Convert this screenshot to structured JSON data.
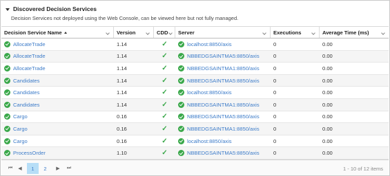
{
  "panel": {
    "title": "Discovered Decision Services",
    "subtitle": "Decision Services not deployed using the Web Console, can be viewed here but not fully managed."
  },
  "columns": {
    "name": "Decision Service Name",
    "version": "Version",
    "cdd": "CDD",
    "server": "Server",
    "executions": "Executions",
    "avg_time": "Average Time (ms)"
  },
  "rows": [
    {
      "name": "AllocateTrade",
      "version": "1.14",
      "cdd": "✓",
      "server": "localhost:8850/axis",
      "executions": "0",
      "avg": "0.00"
    },
    {
      "name": "AllocateTrade",
      "version": "1.14",
      "cdd": "✓",
      "server": "NBBEDGSAINTMA5:8850/axis",
      "executions": "0",
      "avg": "0.00"
    },
    {
      "name": "AllocateTrade",
      "version": "1.14",
      "cdd": "✓",
      "server": "NBBEDGSAINTMA1:8850/axis",
      "executions": "0",
      "avg": "0.00"
    },
    {
      "name": "Candidates",
      "version": "1.14",
      "cdd": "✓",
      "server": "NBBEDGSAINTMA5:8850/axis",
      "executions": "0",
      "avg": "0.00"
    },
    {
      "name": "Candidates",
      "version": "1.14",
      "cdd": "✓",
      "server": "localhost:8850/axis",
      "executions": "0",
      "avg": "0.00"
    },
    {
      "name": "Candidates",
      "version": "1.14",
      "cdd": "✓",
      "server": "NBBEDGSAINTMA1:8850/axis",
      "executions": "0",
      "avg": "0.00"
    },
    {
      "name": "Cargo",
      "version": "0.16",
      "cdd": "✓",
      "server": "NBBEDGSAINTMA5:8850/axis",
      "executions": "0",
      "avg": "0.00"
    },
    {
      "name": "Cargo",
      "version": "0.16",
      "cdd": "✓",
      "server": "NBBEDGSAINTMA1:8850/axis",
      "executions": "0",
      "avg": "0.00"
    },
    {
      "name": "Cargo",
      "version": "0.16",
      "cdd": "✓",
      "server": "localhost:8850/axis",
      "executions": "0",
      "avg": "0.00"
    },
    {
      "name": "ProcessOrder",
      "version": "1.10",
      "cdd": "✓",
      "server": "NBBEDGSAINTMA5:8850/axis",
      "executions": "0",
      "avg": "0.00"
    }
  ],
  "pager": {
    "first": "⏮",
    "prev": "◀",
    "next": "▶",
    "last": "⏭",
    "pages": [
      "1",
      "2"
    ],
    "current_page": "1",
    "info": "1 - 10 of 12 items"
  },
  "colors": {
    "link": "#3d7cc9",
    "success": "#3aa84a",
    "active_page": "#b6def7"
  }
}
